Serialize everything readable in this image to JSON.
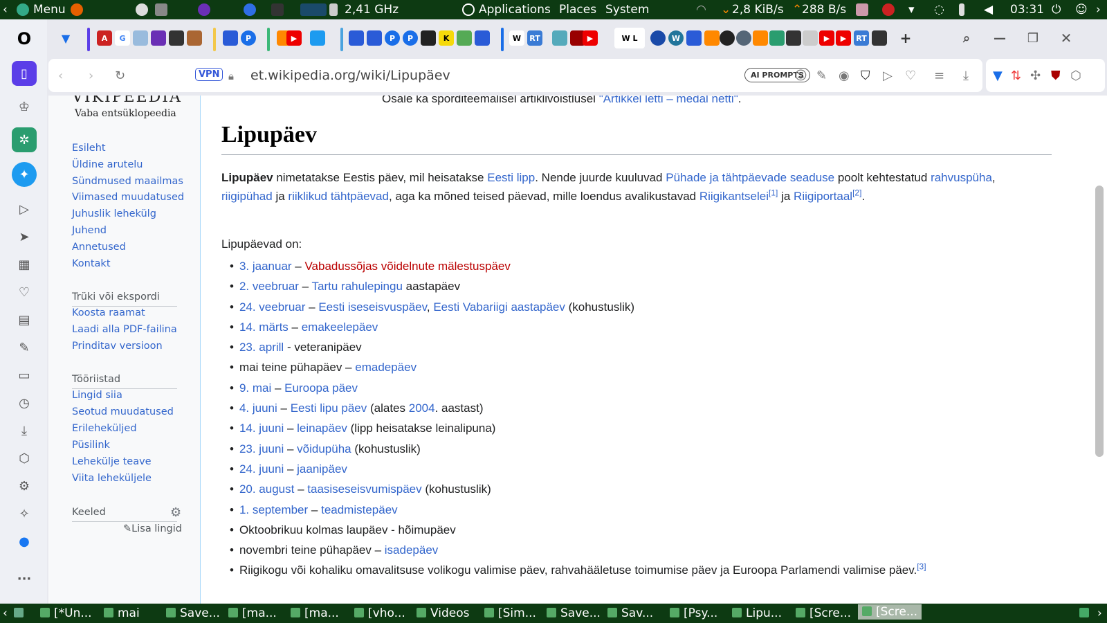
{
  "topbar": {
    "menu": "Menu",
    "cpu": "2,41 GHz",
    "applications": "Applications",
    "places": "Places",
    "system": "System",
    "net_down": "2,8 KiB/s",
    "net_up": "288 B/s",
    "clock": "03:31"
  },
  "browser": {
    "url": "et.wikipedia.org/wiki/Lipupäev",
    "vpn": "VPN",
    "ai_prompts": "AI PROMPTS"
  },
  "wiki": {
    "logo_title": "VIKIPEEDIA",
    "logo_tagline": "Vaba entsüklopeedia",
    "nav_main": [
      "Esileht",
      "Üldine arutelu",
      "Sündmused maailmas",
      "Viimased muudatused",
      "Juhuslik lehekülg",
      "Juhend",
      "Annetused",
      "Kontakt"
    ],
    "print_heading": "Trüki või ekspordi",
    "nav_print": [
      "Koosta raamat",
      "Laadi alla PDF-failina",
      "Prinditav versioon"
    ],
    "tools_heading": "Tööriistad",
    "nav_tools": [
      "Lingid siia",
      "Seotud muudatused",
      "Erileheküljed",
      "Püsilink",
      "Lehekülje teave",
      "Viita leheküljele"
    ],
    "languages_heading": "Keeled",
    "add_links": "Lisa lingid"
  },
  "article": {
    "prev_text": "Osale ka spordi­teemalisel artikli­võistlusel ",
    "prev_link": "\"Artikkel letti – medal netti\"",
    "prev_end": ".",
    "title": "Lipupäev",
    "p": {
      "bold": "Lipupäev",
      "t1": " nimetatakse Eestis päev, mil heisatakse ",
      "l1": "Eesti lipp",
      "t2": ". Nende juurde kuuluvad ",
      "l2": "Pühade ja tähtpäevade seaduse",
      "t3": " poolt kehtestatud ",
      "l3": "rahvuspüha",
      "t4": ", ",
      "l4": "riigipühad",
      "t5": " ja ",
      "l5": "riiklikud tähtpäevad",
      "t6": ", aga ka mõned teised päevad, mille loendus avalikustavad ",
      "l6": "Riigikantselei",
      "r1": "[1]",
      "t7": " ja ",
      "l7": "Riigiportaal",
      "r2": "[2]",
      "t8": "."
    },
    "intro": "Lipupäevad on:",
    "items": [
      [
        [
          "a",
          "3. jaanuar"
        ],
        [
          "t",
          " – "
        ],
        [
          "r",
          "Vabadussõjas võidelnute mälestuspäev"
        ]
      ],
      [
        [
          "a",
          "2. veebruar"
        ],
        [
          "t",
          " – "
        ],
        [
          "a",
          "Tartu rahulepingu"
        ],
        [
          "t",
          " aastapäev"
        ]
      ],
      [
        [
          "a",
          "24. veebruar"
        ],
        [
          "t",
          " – "
        ],
        [
          "a",
          "Eesti iseseisvuspäev"
        ],
        [
          "t",
          ", "
        ],
        [
          "a",
          "Eesti Vabariigi aastapäev"
        ],
        [
          "t",
          " (kohustuslik)"
        ]
      ],
      [
        [
          "a",
          "14. märts"
        ],
        [
          "t",
          " – "
        ],
        [
          "a",
          "emakeelepäev"
        ]
      ],
      [
        [
          "a",
          "23. aprill"
        ],
        [
          "t",
          " - veteranipäev"
        ]
      ],
      [
        [
          "t",
          "mai teine pühapäev – "
        ],
        [
          "a",
          "emadepäev"
        ]
      ],
      [
        [
          "a",
          "9. mai"
        ],
        [
          "t",
          " – "
        ],
        [
          "a",
          "Euroopa päev"
        ]
      ],
      [
        [
          "a",
          "4. juuni"
        ],
        [
          "t",
          " – "
        ],
        [
          "a",
          "Eesti lipu päev"
        ],
        [
          "t",
          " (alates "
        ],
        [
          "a",
          "2004"
        ],
        [
          "t",
          ". aastast)"
        ]
      ],
      [
        [
          "a",
          "14. juuni"
        ],
        [
          "t",
          " – "
        ],
        [
          "a",
          "leinapäev"
        ],
        [
          "t",
          " (lipp heisatakse leinalipuna)"
        ]
      ],
      [
        [
          "a",
          "23. juuni"
        ],
        [
          "t",
          " – "
        ],
        [
          "a",
          "võidupüha"
        ],
        [
          "t",
          " (kohustuslik)"
        ]
      ],
      [
        [
          "a",
          "24. juuni"
        ],
        [
          "t",
          " – "
        ],
        [
          "a",
          "jaanipäev"
        ]
      ],
      [
        [
          "a",
          "20. august"
        ],
        [
          "t",
          " – "
        ],
        [
          "a",
          "taasiseseisvumispäev"
        ],
        [
          "t",
          " (kohustuslik)"
        ]
      ],
      [
        [
          "a",
          "1. september"
        ],
        [
          "t",
          " – "
        ],
        [
          "a",
          "teadmistepäev"
        ]
      ],
      [
        [
          "t",
          "Oktoobrikuu kolmas laupäev - hõimupäev"
        ]
      ],
      [
        [
          "t",
          "novembri teine pühapäev – "
        ],
        [
          "a",
          "isadepäev"
        ]
      ],
      [
        [
          "t",
          "Riigikogu või kohaliku omavalitsuse volikogu valimise päev, rahvahääletuse toimumise päev ja Euroopa Parlamendi valimise päev."
        ],
        [
          "s",
          "[3]"
        ]
      ]
    ]
  },
  "taskbar": [
    "[*Un...",
    "mai",
    "Save...",
    "[ma...",
    "[ma...",
    "[vho...",
    "Videos",
    "[Sim...",
    "Save...",
    "Sav...",
    "[Psy...",
    "Lipu...",
    "[Scre...",
    "[Scre..."
  ]
}
